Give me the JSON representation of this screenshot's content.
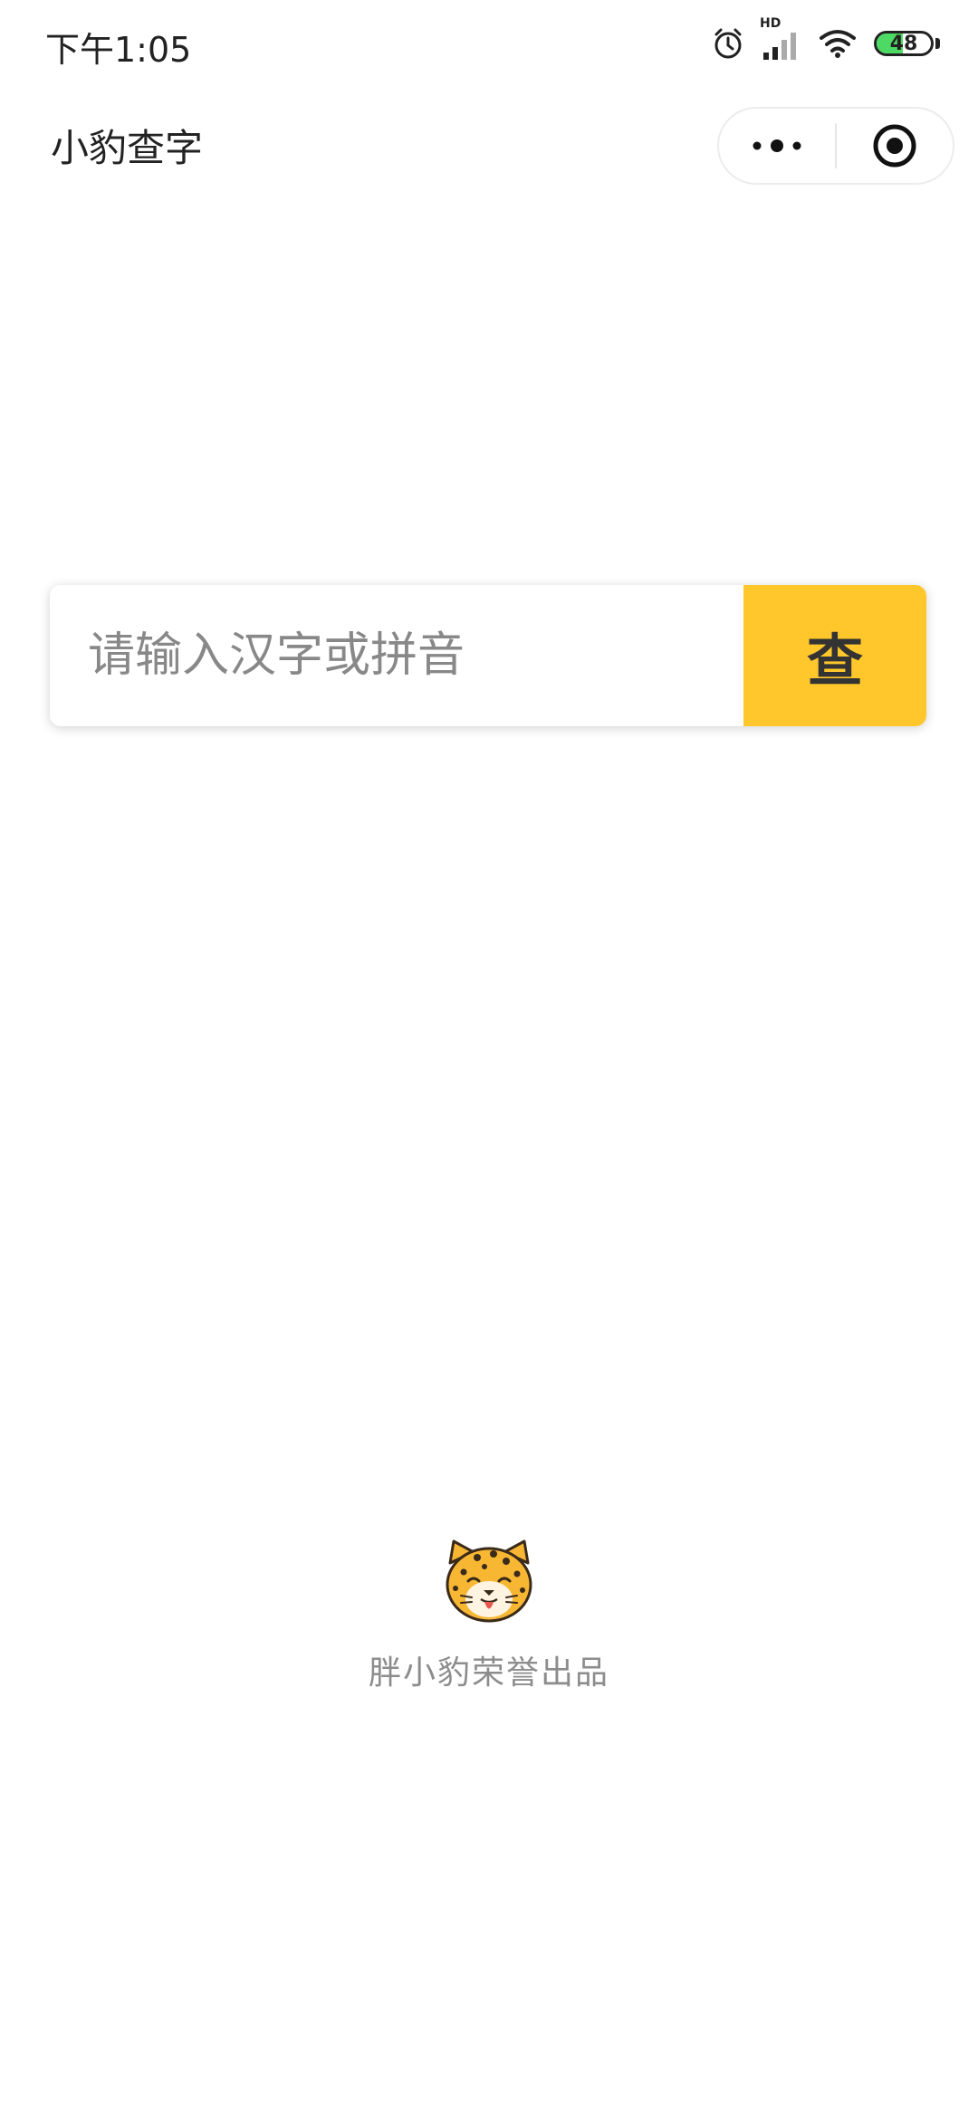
{
  "status_bar": {
    "time": "下午1:05",
    "network_label": "HD",
    "battery_level": 48,
    "battery_text": "48",
    "icons": [
      "alarm-icon",
      "signal-icon",
      "wifi-icon",
      "battery-icon"
    ]
  },
  "nav": {
    "title": "小豹查字",
    "capsule_icons": [
      "more-icon",
      "close-miniprogram-icon"
    ]
  },
  "search": {
    "placeholder": "请输入汉字或拼音",
    "value": "",
    "button_label": "查"
  },
  "footer": {
    "mascot_icon": "leopard-mascot-icon",
    "text": "胖小豹荣誉出品"
  },
  "colors": {
    "accent": "#ffc72b",
    "battery_fill": "#4cd964",
    "footer_text": "#8c8c8c"
  }
}
